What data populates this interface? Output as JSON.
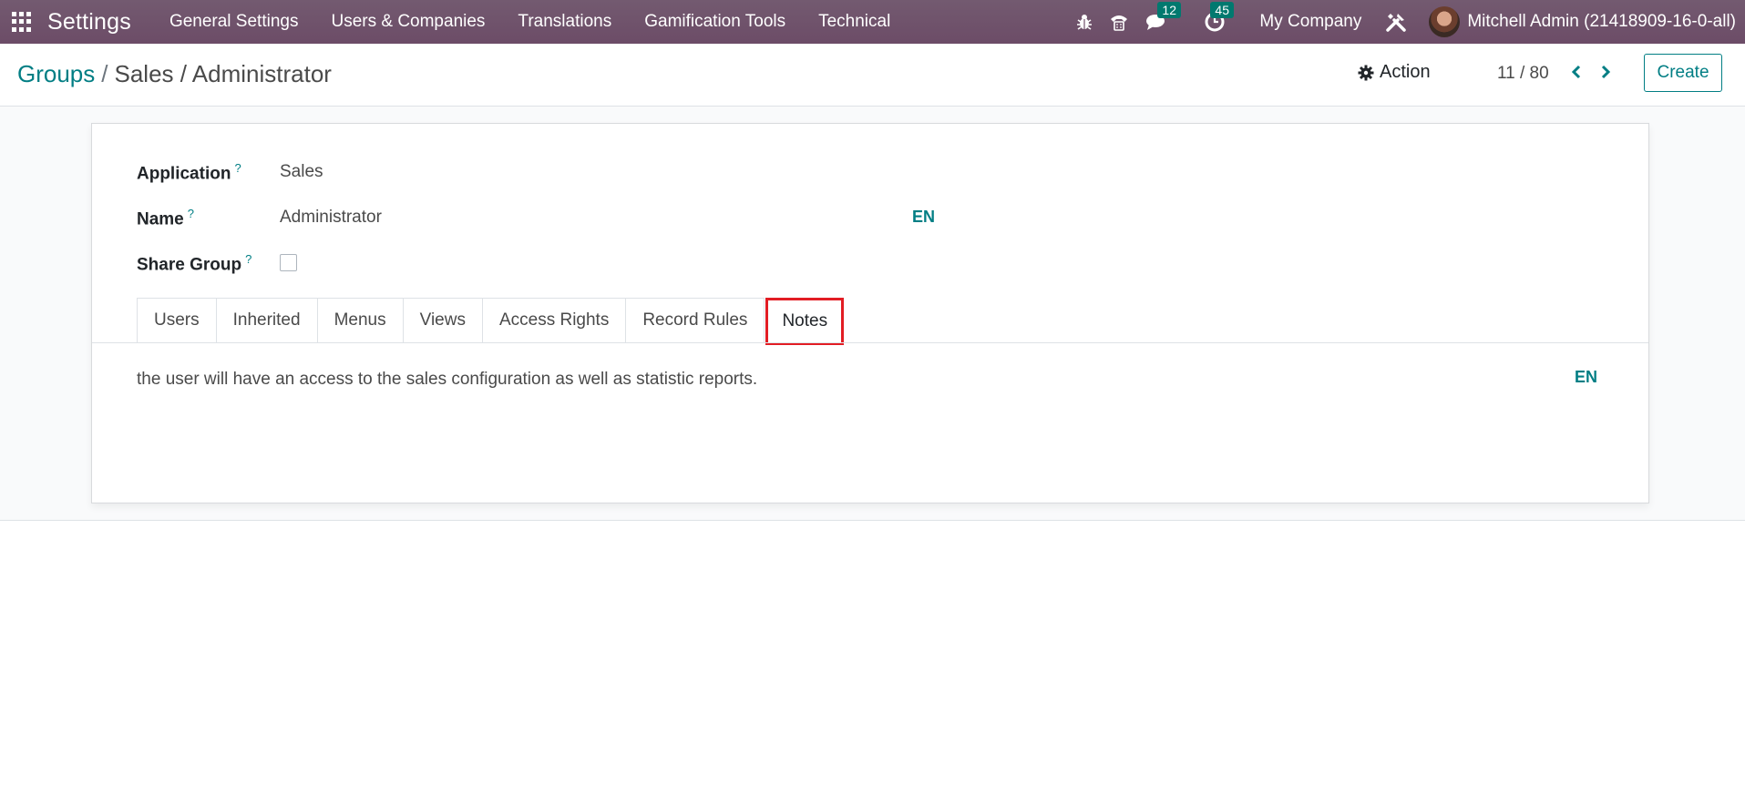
{
  "navbar": {
    "app_title": "Settings",
    "menu": [
      "General Settings",
      "Users & Companies",
      "Translations",
      "Gamification Tools",
      "Technical"
    ],
    "chat_count": "12",
    "activity_count": "45",
    "company": "My Company",
    "user": "Mitchell Admin (21418909-16-0-all)"
  },
  "breadcrumb": {
    "root": "Groups",
    "separator": "/",
    "current": "Sales / Administrator"
  },
  "control": {
    "action_label": "Action",
    "pager": "11 / 80",
    "create_label": "Create"
  },
  "form": {
    "application_label": "Application",
    "application_value": "Sales",
    "name_label": "Name",
    "name_value": "Administrator",
    "share_group_label": "Share Group",
    "help_mark": "?",
    "lang": "EN",
    "share_group_checked": false
  },
  "tabs": [
    "Users",
    "Inherited",
    "Menus",
    "Views",
    "Access Rights",
    "Record Rules",
    "Notes"
  ],
  "notes": {
    "text": "the user will have an access to the sales configuration as well as statistic reports.",
    "lang": "EN"
  },
  "colors": {
    "navbar": "#71506b",
    "accent": "#017e84",
    "highlight": "#e21d24",
    "badge": "#01796f"
  }
}
